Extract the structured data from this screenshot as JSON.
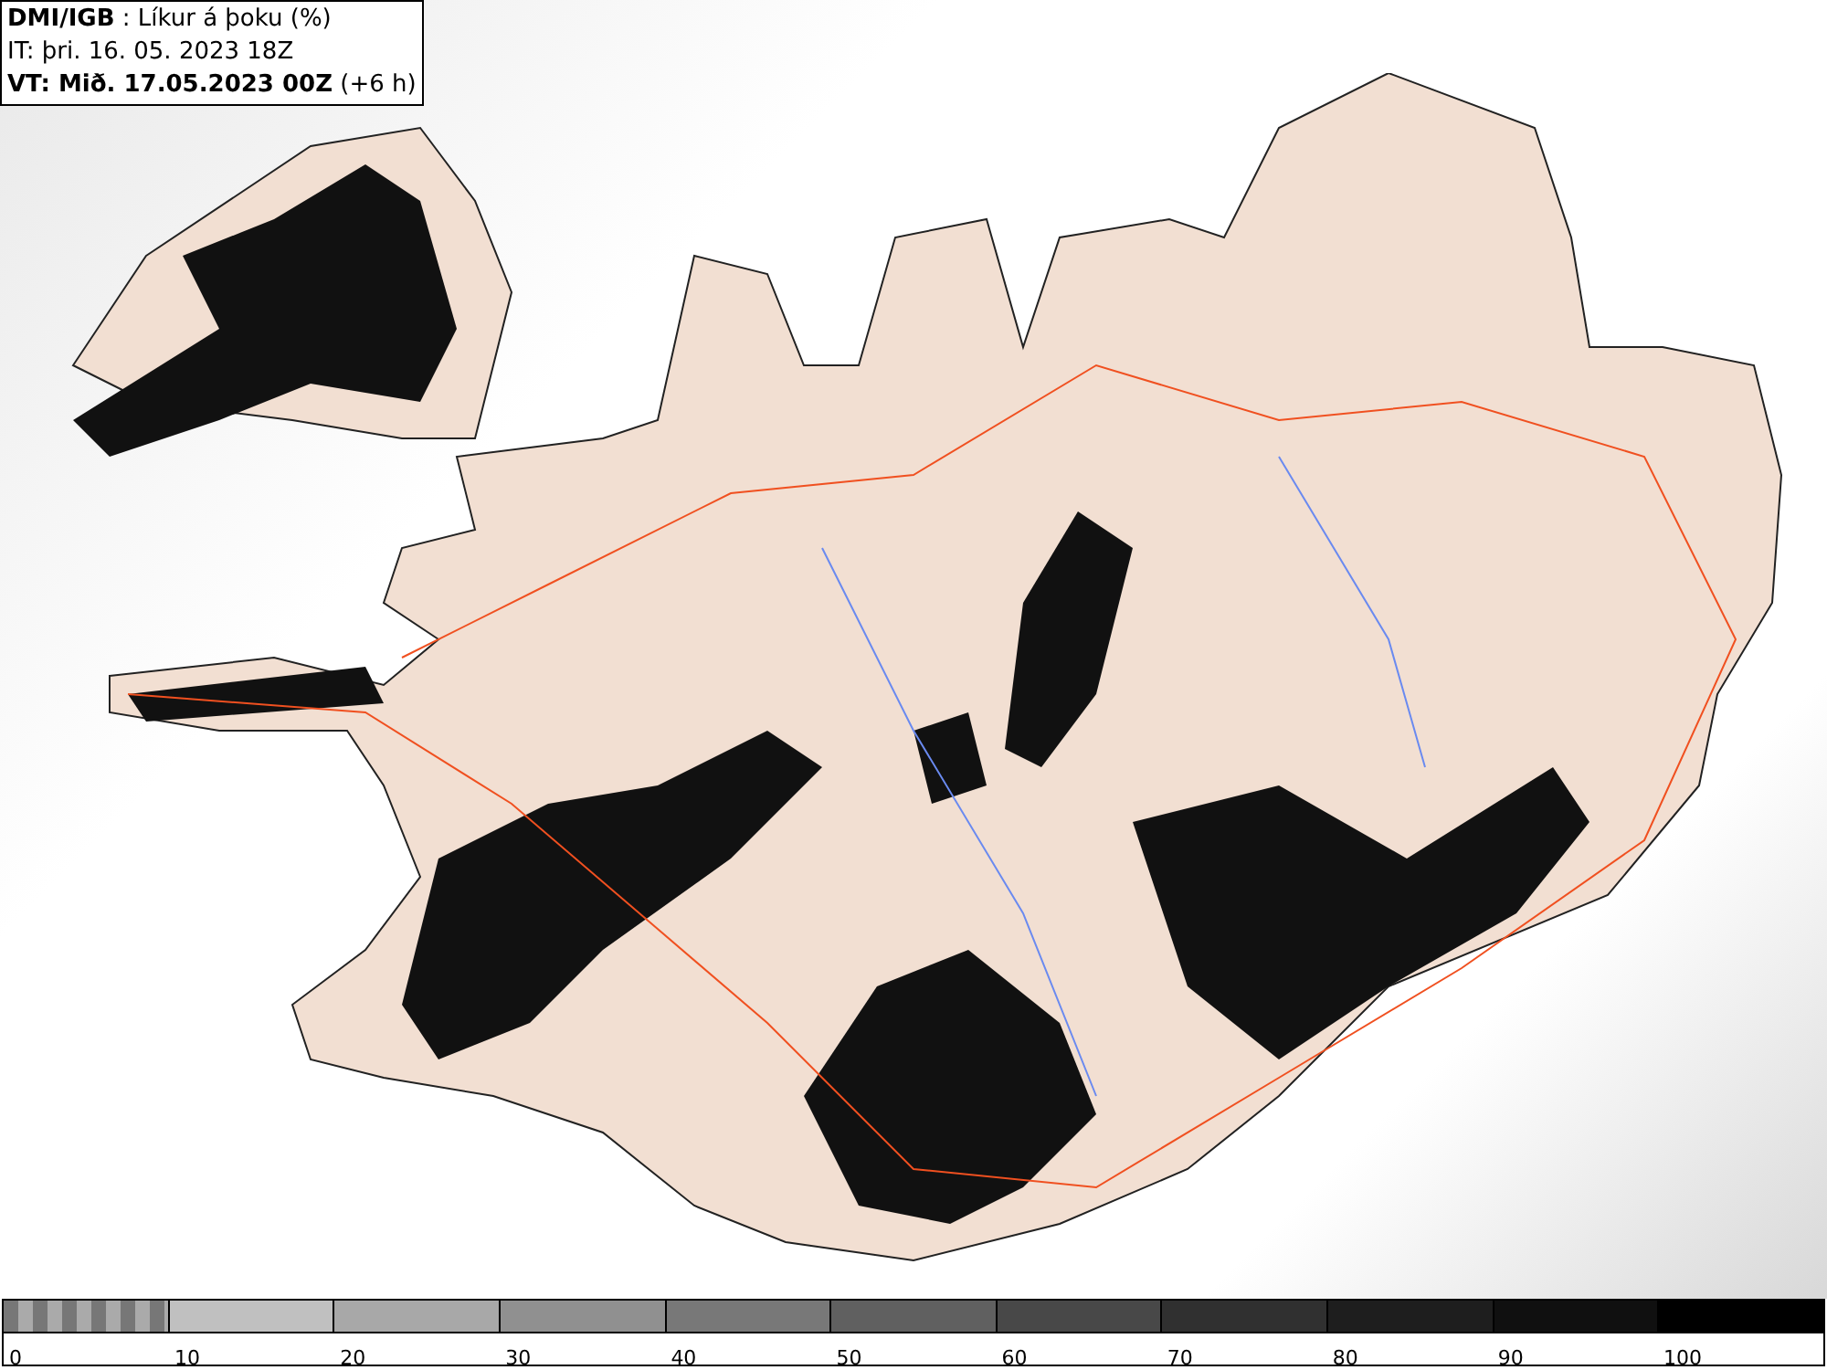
{
  "title_box": {
    "lines": [
      "**DMI/IGB** : Líkur á þoku (%)",
      "IT: þri. 16. 05. 2023 18Z",
      "**VT: Mið. 17.05.2023 00Z** (+6 h)"
    ]
  },
  "legend": {
    "segments": [
      {
        "kind": "checker",
        "label": "0"
      },
      {
        "kind": "solid",
        "color": "#c0c0c0",
        "label": "10"
      },
      {
        "kind": "solid",
        "color": "#a8a8a8",
        "label": "20"
      },
      {
        "kind": "solid",
        "color": "#909090",
        "label": "30"
      },
      {
        "kind": "solid",
        "color": "#787878",
        "label": "40"
      },
      {
        "kind": "solid",
        "color": "#606060",
        "label": "50"
      },
      {
        "kind": "solid",
        "color": "#484848",
        "label": "60"
      },
      {
        "kind": "solid",
        "color": "#303030",
        "label": "70"
      },
      {
        "kind": "solid",
        "color": "#1e1e1e",
        "label": "80"
      },
      {
        "kind": "solid",
        "color": "#101010",
        "label": "90"
      },
      {
        "kind": "solid",
        "color": "#000000",
        "label": "100"
      }
    ]
  }
}
